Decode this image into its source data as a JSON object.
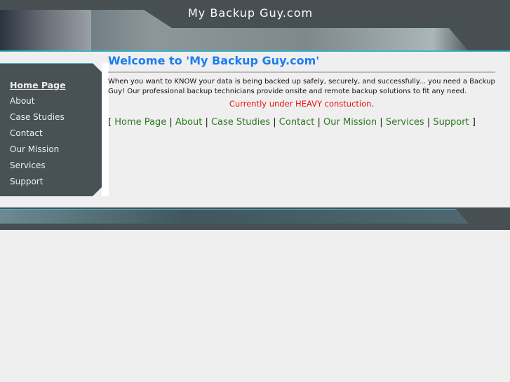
{
  "header": {
    "title": "My Backup Guy.com"
  },
  "sidebar": {
    "items": [
      {
        "label": "Home Page"
      },
      {
        "label": "About"
      },
      {
        "label": "Case Studies"
      },
      {
        "label": "Contact"
      },
      {
        "label": "Our Mission"
      },
      {
        "label": "Services"
      },
      {
        "label": "Support"
      }
    ]
  },
  "main": {
    "heading": "Welcome to 'My Backup Guy.com'",
    "intro": "When you want to KNOW your data is being backed up safely, securely, and successfully... you need a Backup Guy!  Our professional backup technicians provide onsite and remote backup solutions to fit any need.",
    "notice": "Currently under HEAVY constuction",
    "notice_suffix": ".",
    "open": "[ ",
    "sep": " | ",
    "close": " ]",
    "links": [
      {
        "label": "Home Page"
      },
      {
        "label": "About"
      },
      {
        "label": "Case Studies"
      },
      {
        "label": "Contact"
      },
      {
        "label": "Our Mission"
      },
      {
        "label": "Services"
      },
      {
        "label": "Support"
      }
    ]
  }
}
